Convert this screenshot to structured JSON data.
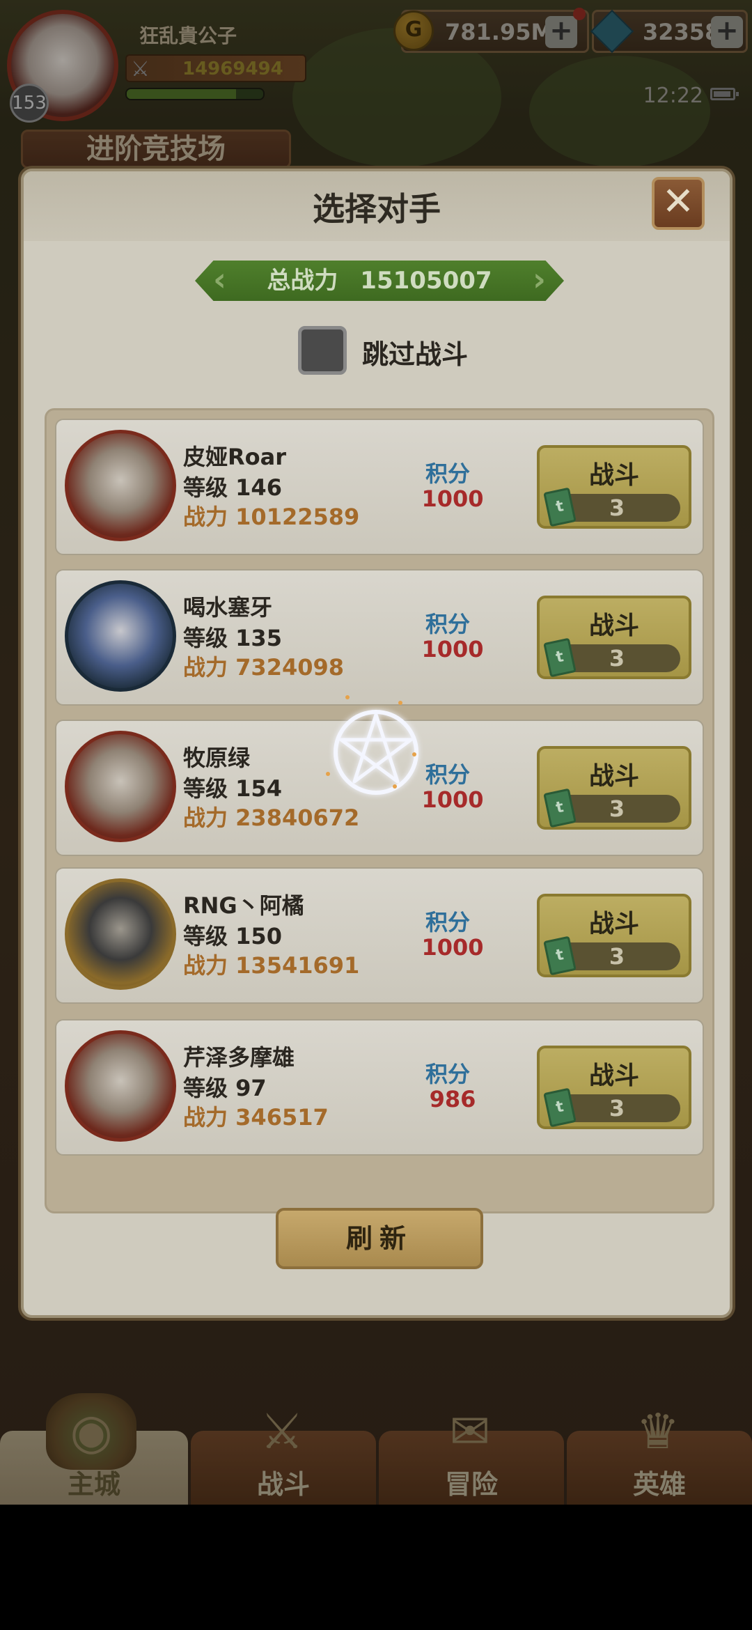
{
  "hud": {
    "player_name": "狂乱貴公子",
    "player_level": "153",
    "power": "14969494",
    "xp_fraction": 0.8,
    "gold": "781.95M",
    "gems": "32358",
    "plus": "+",
    "time": "12:22",
    "mode_title": "进阶竞技场"
  },
  "dialog": {
    "title": "选择对手",
    "close": "✕",
    "total_power_label": "总战力",
    "total_power_value": "15105007",
    "skip_label": "跳过战斗",
    "refresh_label": "刷新"
  },
  "labels": {
    "level": "等级",
    "power": "战力",
    "score": "积分",
    "fight": "战斗"
  },
  "opponents": [
    {
      "name": "皮娅Roar",
      "level": "146",
      "power": "10122589",
      "score": "1000",
      "tickets": "3"
    },
    {
      "name": "喝水塞牙",
      "level": "135",
      "power": "7324098",
      "score": "1000",
      "tickets": "3"
    },
    {
      "name": "牧原绿",
      "level": "154",
      "power": "23840672",
      "score": "1000",
      "tickets": "3"
    },
    {
      "name": "RNG丶阿橘",
      "level": "150",
      "power": "13541691",
      "score": "1000",
      "tickets": "3"
    },
    {
      "name": "芹泽多摩雄",
      "level": "97",
      "power": "346517",
      "score": "986",
      "tickets": "3"
    }
  ],
  "nav": {
    "tabs": [
      {
        "label": "主城",
        "active": true
      },
      {
        "label": "战斗",
        "active": false
      },
      {
        "label": "冒险",
        "active": false
      },
      {
        "label": "英雄",
        "active": false
      }
    ]
  },
  "colors": {
    "accent_green": "#4f7f2c",
    "score_red": "#a62a2a",
    "power_orange": "#a46a2a",
    "score_blue": "#2f6f9a"
  }
}
